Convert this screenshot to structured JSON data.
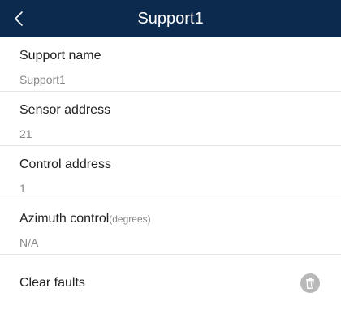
{
  "header": {
    "title": "Support1",
    "back_icon": "chevron-left-icon"
  },
  "fields": [
    {
      "label": "Support name",
      "unit": "",
      "value": "Support1"
    },
    {
      "label": "Sensor address",
      "unit": "",
      "value": "21"
    },
    {
      "label": "Control address",
      "unit": "",
      "value": "1"
    },
    {
      "label": "Azimuth control",
      "unit": "(degrees)",
      "value": "N/A"
    }
  ],
  "action": {
    "label": "Clear faults",
    "icon": "trash-icon"
  },
  "colors": {
    "header_bg": "#0c2a4e",
    "label_text": "#222222",
    "value_text": "#8a8a8a",
    "divider": "#e6e6e6",
    "icon_bg": "#b9b9b9"
  }
}
